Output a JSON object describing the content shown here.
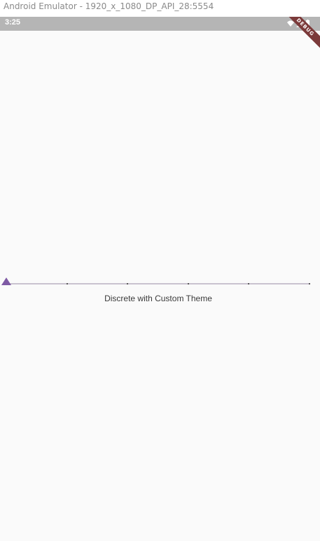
{
  "window": {
    "title": "Android Emulator - 1920_x_1080_DP_API_28:5554"
  },
  "status_bar": {
    "time": "3:25",
    "icons": [
      "wifi-icon",
      "signal-icon",
      "battery-icon"
    ]
  },
  "debug_banner": {
    "label": "DEBUG",
    "color": "#7b3a3a"
  },
  "slider": {
    "value": 0,
    "min": 0,
    "max": 5,
    "divisions": 5,
    "thumb_shape": "triangle",
    "thumb_color": "#7e5aa4",
    "track_color": "#c9c2cf",
    "caption": "Discrete with Custom Theme"
  }
}
